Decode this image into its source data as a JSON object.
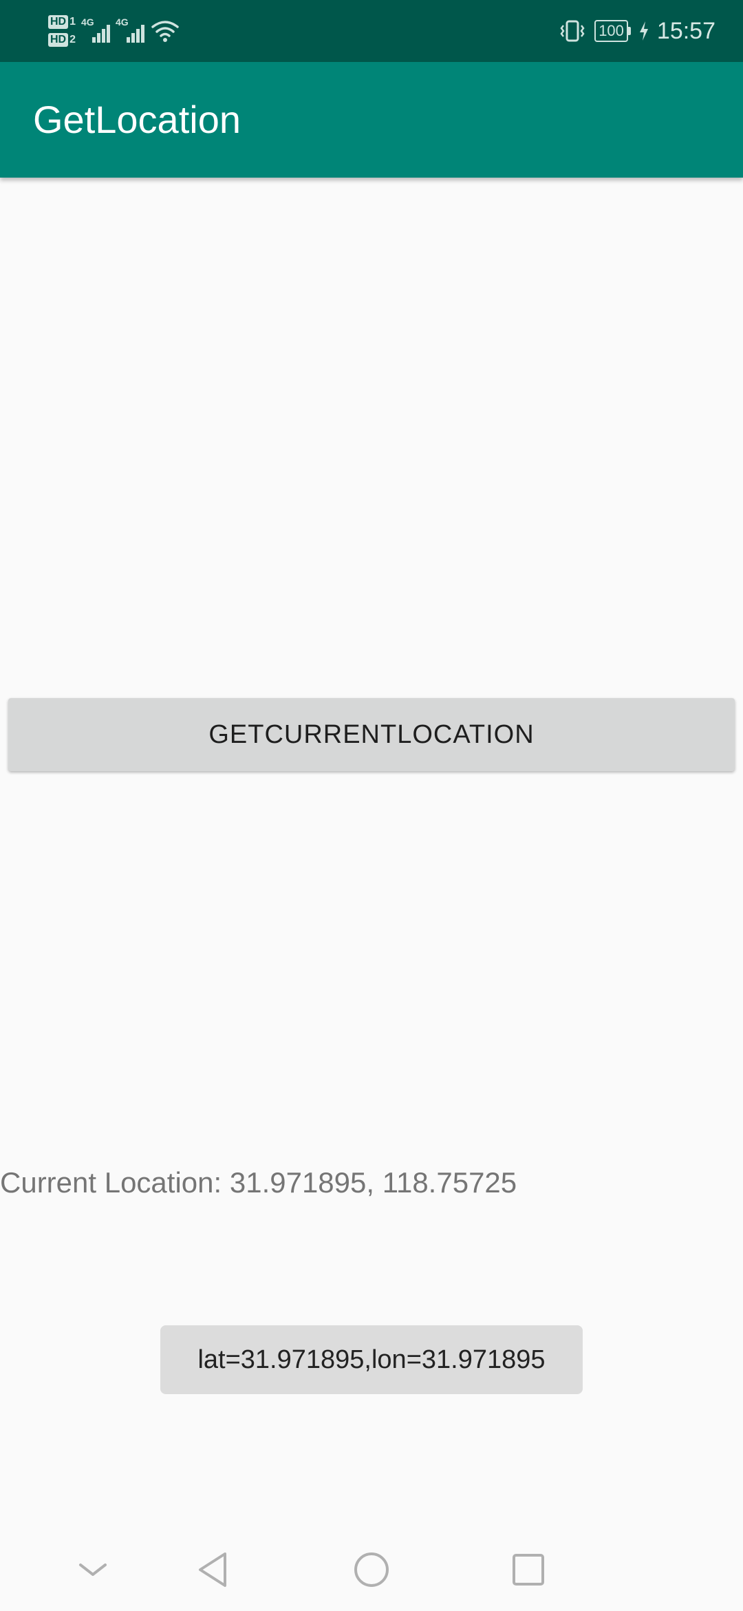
{
  "status_bar": {
    "sim_badges": [
      "HD",
      "HD"
    ],
    "sim_numbers": [
      "1",
      "2"
    ],
    "network_types": [
      "4G",
      "4G"
    ],
    "icons": [
      "hd-icon",
      "signal-icon",
      "wifi-icon",
      "vibrate-icon",
      "battery-icon",
      "charging-icon"
    ],
    "battery_level": "100",
    "time": "15:57"
  },
  "app_bar": {
    "title": "GetLocation"
  },
  "main": {
    "button_label": "GETCURRENTLOCATION",
    "location_text": "Current Location: 31.971895, 118.75725"
  },
  "toast": {
    "message": "lat=31.971895,lon=31.971895"
  },
  "nav_bar": {
    "icons": [
      "chevron-down-icon",
      "back-icon",
      "home-icon",
      "recents-icon"
    ]
  },
  "colors": {
    "status_bar": "#00574b",
    "app_bar": "#008577",
    "background": "#fafafa",
    "button": "#d6d7d7",
    "toast": "#dcdcdc"
  }
}
